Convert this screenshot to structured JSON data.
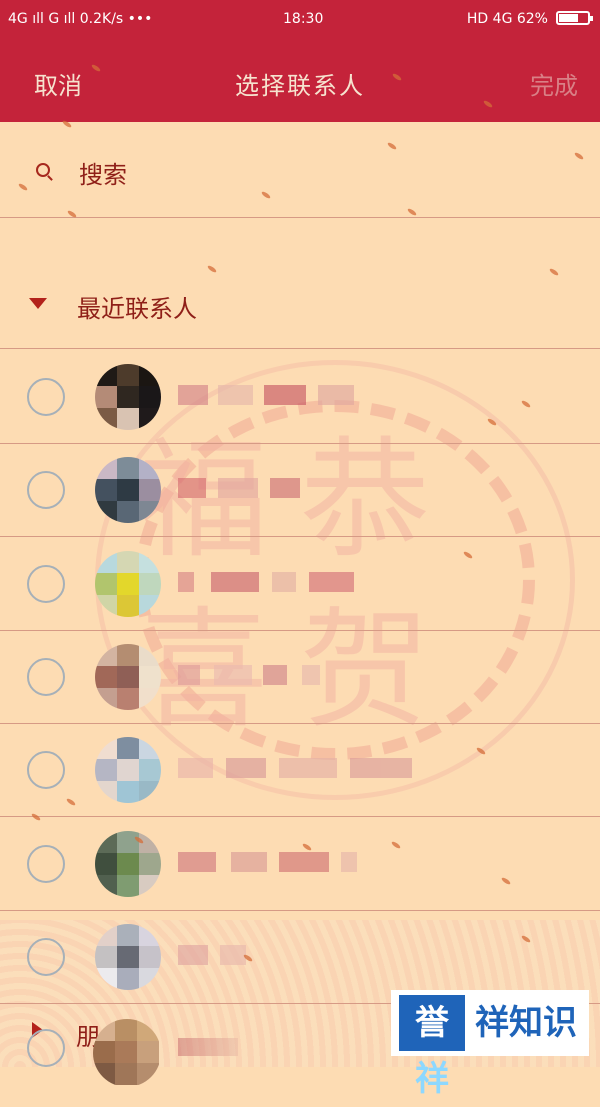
{
  "status_bar": {
    "left": "4G ıll  G ıll  0.2K/s •••",
    "time": "18:30",
    "right": "HD 4G  62%",
    "battery_percent": 62
  },
  "header": {
    "cancel": "取消",
    "title": "选择联系人",
    "done": "完成"
  },
  "search": {
    "label": "搜索"
  },
  "recent_section": {
    "label": "最近联系人"
  },
  "footer_section": {
    "label": "朋"
  },
  "badge": {
    "text_1": "誉",
    "text_2": "祥",
    "text_3": "祥知识"
  },
  "colors": {
    "accent": "#c4233a",
    "background": "#fddcb3",
    "text": "#8f1f18",
    "badge_blue": "#1f64b9"
  }
}
